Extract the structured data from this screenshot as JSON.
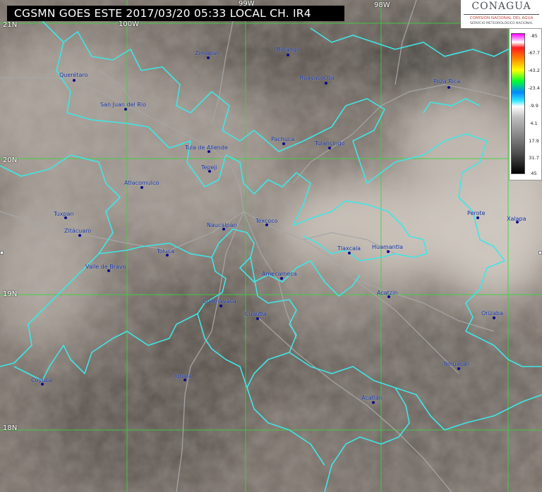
{
  "title": "CGSMN GOES ESTE 2017/03/20 05:33 LOCAL  CH. IR4",
  "logo": {
    "name": "CONAGUA",
    "line1": "COMISIÓN NACIONAL DEL AGUA",
    "line2": "SERVICIO METEOROLÓGICO NACIONAL"
  },
  "scale": {
    "labels": [
      "-85",
      "-67.7",
      "-43.2",
      "-23.4",
      "-9.9",
      "4.1",
      "17.9",
      "31.7",
      "45"
    ]
  },
  "grid": {
    "latitudes": [
      "21N",
      "20N",
      "19N",
      "18N"
    ],
    "longitudes": [
      "100W",
      "99W",
      "98W"
    ]
  },
  "cities": [
    "Zimapan",
    "Molango",
    "Querétaro",
    "Huayacoctla",
    "Poza Rica",
    "San Juan del Rio",
    "Pachuca",
    "Tulancingo",
    "Tula de Allende",
    "Tepeji",
    "Atlacomulco",
    "Tuxpan",
    "Zitácuaro",
    "Naucalpan",
    "Texcoco",
    "Toluca",
    "Tlaxcala",
    "Huamantla",
    "Perote",
    "Xalapa",
    "Valle de Bravo",
    "Amecameca",
    "Acatzin",
    "Cuernavaca",
    "Cuautla",
    "Orizaba",
    "Tehuacán",
    "Iguala",
    "Coyuca",
    "Acatlán"
  ],
  "colors": {
    "state_border": "#3fe6e6",
    "grid": "#39d53b",
    "road": "#a6a6a6",
    "city_dot": "#0b0b8c",
    "city_label": "#0c2a9a"
  }
}
